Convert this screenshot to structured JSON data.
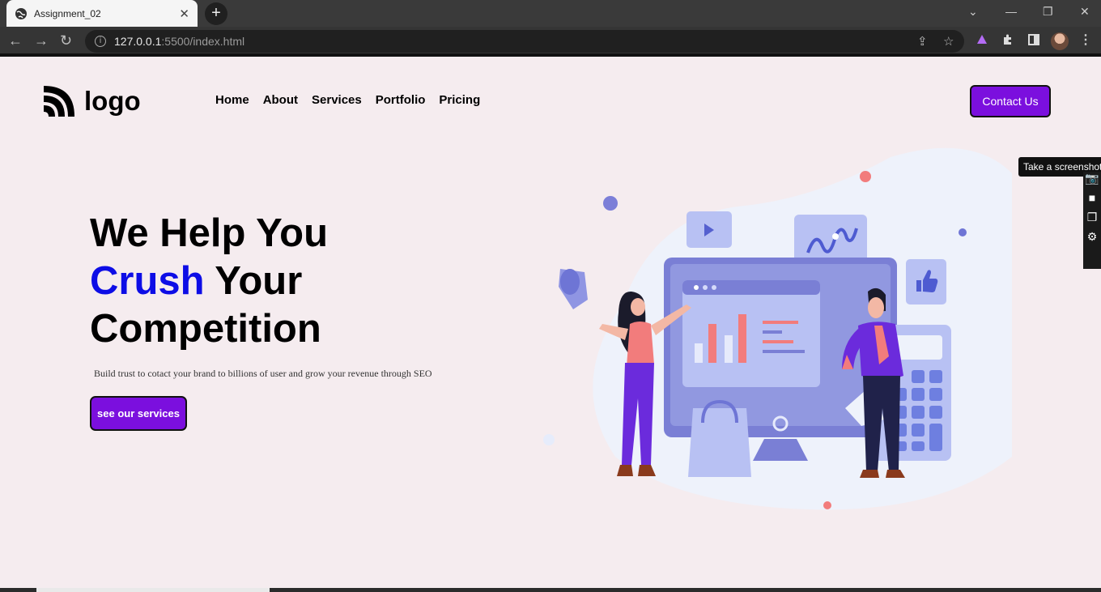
{
  "browser": {
    "tab_title": "Assignment_02",
    "url_host": "127.0.0.1",
    "url_path": ":5500/index.html"
  },
  "header": {
    "logo_text": "logo",
    "nav": [
      "Home",
      "About",
      "Services",
      "Portfolio",
      "Pricing"
    ],
    "contact_label": "Contact Us"
  },
  "hero": {
    "line1": "We Help You",
    "line2_accent": "Crush",
    "line2_rest": " Your",
    "line3": "Competition",
    "subtext": "Build trust to cotact your brand to billions of user and grow your revenue through SEO",
    "cta_label": "see our services"
  },
  "widget": {
    "tooltip": "Take a screenshot"
  },
  "colors": {
    "accent": "#7b0fde",
    "headline_accent": "#0d0de6",
    "page_bg": "#f5ecef"
  }
}
